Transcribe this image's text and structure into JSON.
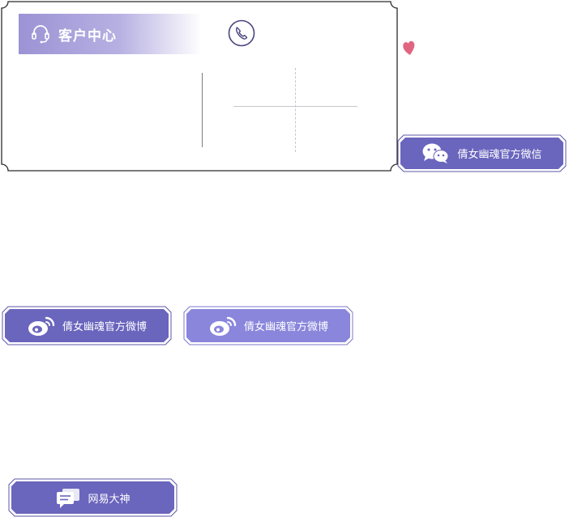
{
  "customer_center": {
    "title": "客户中心"
  },
  "buttons": {
    "wechat_label": "倩女幽魂官方微信",
    "weibo_label": "倩女幽魂官方微博",
    "weibo_hover_label": "倩女幽魂官方微博",
    "dashen_label": "网易大神"
  },
  "colors": {
    "button_primary": "#6a65bd",
    "button_hover": "#8a86dc",
    "header_gradient_start": "#9b93d4",
    "heart": "#e0657f",
    "icon_stroke": "#4a4580"
  },
  "icons": {
    "header": "headset-icon",
    "phone": "phone-icon",
    "heart": "heart-icon",
    "wechat": "wechat-icon",
    "weibo": "weibo-icon",
    "dashen": "chat-bubble-icon"
  }
}
